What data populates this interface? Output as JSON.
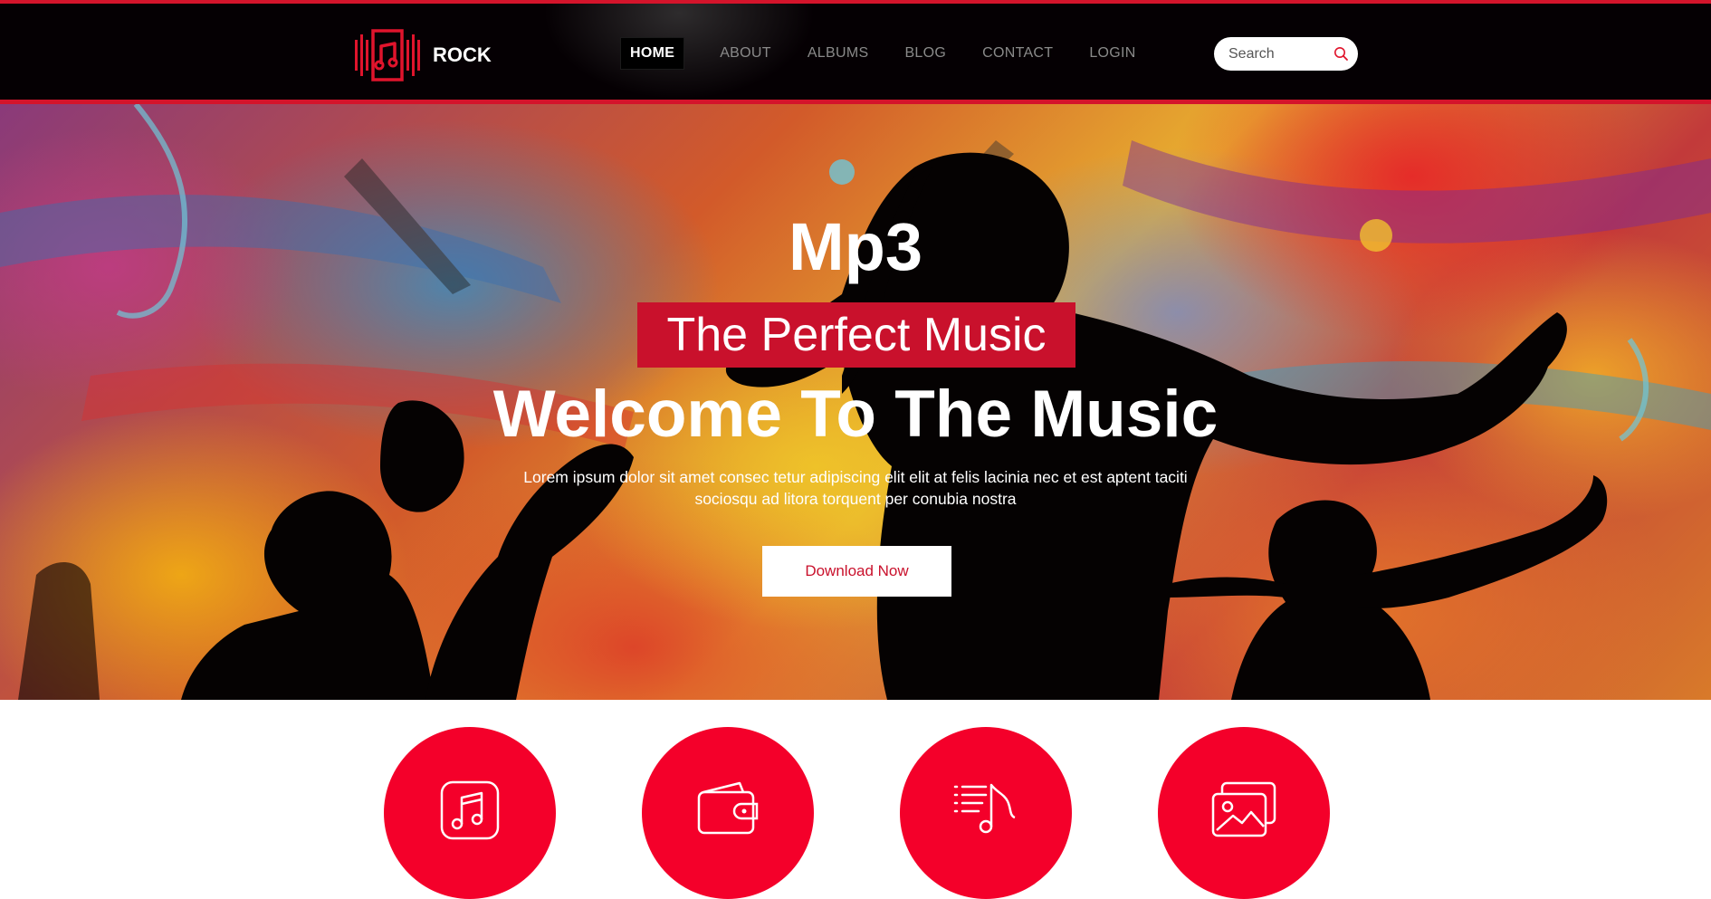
{
  "brand": {
    "name": "ROCK"
  },
  "nav": {
    "items": [
      {
        "label": "HOME",
        "active": true
      },
      {
        "label": "ABOUT"
      },
      {
        "label": "ALBUMS"
      },
      {
        "label": "BLOG"
      },
      {
        "label": "CONTACT"
      },
      {
        "label": "LOGIN"
      }
    ]
  },
  "search": {
    "placeholder": "Search"
  },
  "hero": {
    "kicker": "Mp3",
    "tag": "The Perfect Music",
    "title": "Welcome To The Music",
    "description": "Lorem ipsum dolor sit amet consec tetur adipiscing elit elit at felis lacinia nec et est aptent taciti sociosqu ad litora torquent per conubia nostra",
    "button_label": "Download Now"
  },
  "features": [
    {
      "icon": "music-note-icon"
    },
    {
      "icon": "wallet-icon"
    },
    {
      "icon": "playlist-icon"
    },
    {
      "icon": "gallery-icon"
    }
  ],
  "colors": {
    "accent": "#f4002a",
    "accent_dark": "#c9112c",
    "header_bg": "#050003",
    "header_line": "#d4142b"
  }
}
